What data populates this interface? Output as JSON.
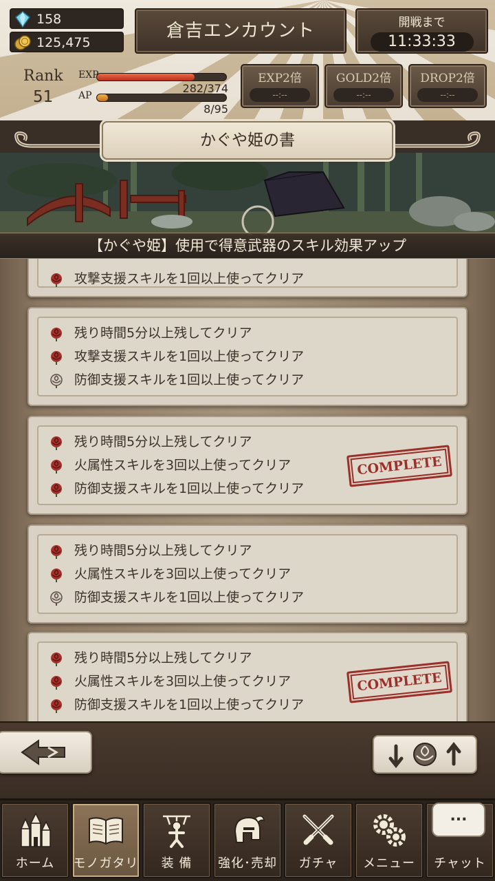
{
  "header": {
    "gems": "158",
    "gold": "125,475",
    "title": "倉吉エンカウント",
    "battle_label": "開戦まで",
    "battle_timer": "11:33:33",
    "rank_label": "Rank",
    "rank_value": "51",
    "exp_label": "EXP",
    "exp_value": "282/374",
    "exp_fraction": 0.754,
    "ap_label": "AP",
    "ap_value": "8/95",
    "ap_fraction": 0.084,
    "boosts": [
      {
        "label": "EXP2倍",
        "value": "--:--"
      },
      {
        "label": "GOLD2倍",
        "value": "--:--"
      },
      {
        "label": "DROP2倍",
        "value": "--:--"
      }
    ]
  },
  "book": {
    "title": "かぐや姫の書",
    "caption": "【かぐや姫】使用で得意武器のスキル効果アップ"
  },
  "cards": [
    {
      "conditions": [
        {
          "text": "攻撃支援スキルを1回以上使ってクリア",
          "cleared": true
        }
      ],
      "complete": false
    },
    {
      "conditions": [
        {
          "text": "残り時間5分以上残してクリア",
          "cleared": true
        },
        {
          "text": "攻撃支援スキルを1回以上使ってクリア",
          "cleared": true
        },
        {
          "text": "防御支援スキルを1回以上使ってクリア",
          "cleared": false
        }
      ],
      "complete": false
    },
    {
      "conditions": [
        {
          "text": "残り時間5分以上残してクリア",
          "cleared": true
        },
        {
          "text": "火属性スキルを3回以上使ってクリア",
          "cleared": true
        },
        {
          "text": "防御支援スキルを1回以上使ってクリア",
          "cleared": true
        }
      ],
      "complete": true
    },
    {
      "conditions": [
        {
          "text": "残り時間5分以上残してクリア",
          "cleared": true
        },
        {
          "text": "火属性スキルを3回以上使ってクリア",
          "cleared": true
        },
        {
          "text": "防御支援スキルを1回以上使ってクリア",
          "cleared": false
        }
      ],
      "complete": false
    },
    {
      "conditions": [
        {
          "text": "残り時間5分以上残してクリア",
          "cleared": true
        },
        {
          "text": "火属性スキルを3回以上使ってクリア",
          "cleared": true
        },
        {
          "text": "防御支援スキルを1回以上使ってクリア",
          "cleared": true
        }
      ],
      "complete": true
    }
  ],
  "stamp_text": "COMPLETE",
  "tabs": [
    {
      "label": "ホーム",
      "icon": "castle-icon"
    },
    {
      "label": "モノガタリ",
      "icon": "book-icon"
    },
    {
      "label": "装 備",
      "icon": "puppet-icon"
    },
    {
      "label": "強化･売却",
      "icon": "helmet-icon"
    },
    {
      "label": "ガチャ",
      "icon": "crossed-swords-icon"
    },
    {
      "label": "メニュー",
      "icon": "gears-icon"
    },
    {
      "label": "チャット",
      "icon": "chat-icon"
    }
  ],
  "chat_bubble": "...",
  "colors": {
    "rose_cleared": "#a3322c",
    "rose_uncleared": "#5a4f45",
    "exp_bar": "#d2452b",
    "ap_bar": "#e0902e",
    "stamp": "#9b2f2a"
  }
}
